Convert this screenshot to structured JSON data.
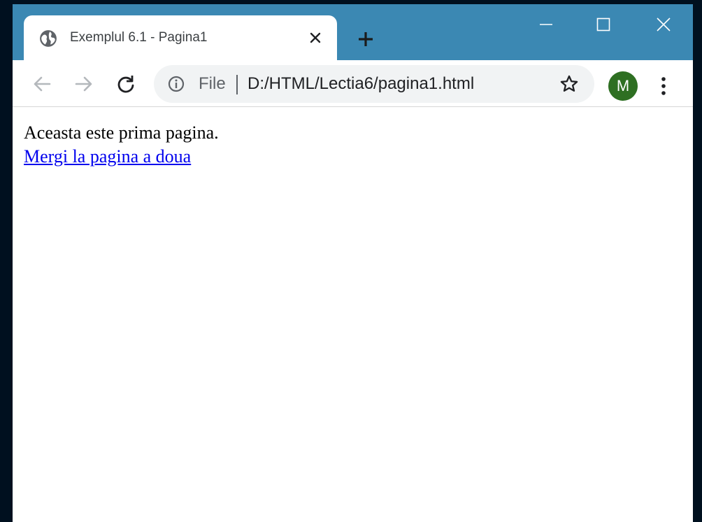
{
  "window": {
    "controls": {
      "minimize": "minimize-icon",
      "maximize": "maximize-icon",
      "close": "close-icon"
    }
  },
  "tab": {
    "title": "Exemplul 6.1 - Pagina1",
    "icon": "globe-icon"
  },
  "toolbar": {
    "back": "back-arrow-icon",
    "forward": "forward-arrow-icon",
    "reload": "reload-icon",
    "omnibox": {
      "scheme_label": "File",
      "url": "D:/HTML/Lectia6/pagina1.html"
    },
    "profile_initial": "M"
  },
  "page": {
    "text": "Aceasta este prima pagina.",
    "link_text": "Mergi la pagina a doua"
  },
  "colors": {
    "titlebar": "#3b88b3",
    "avatar": "#2e6f22",
    "link": "#0000ee",
    "background": "#00101f"
  }
}
